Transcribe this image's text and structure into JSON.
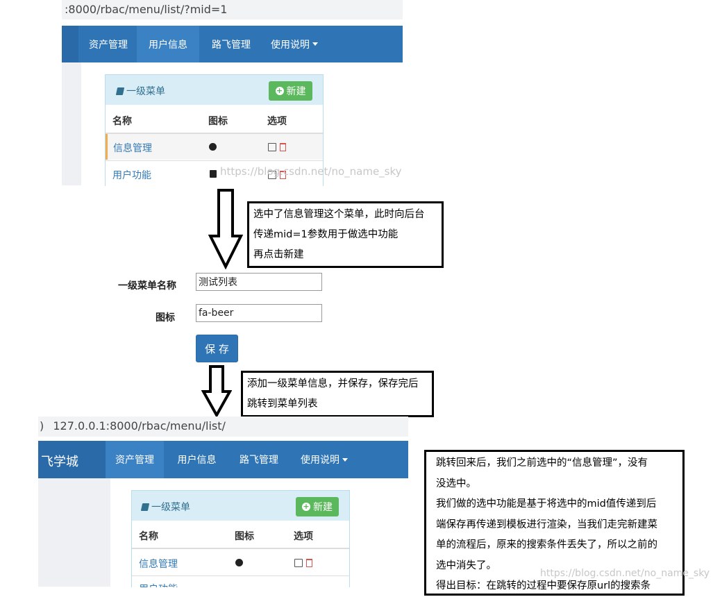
{
  "top": {
    "url": ":8000/rbac/menu/list/?mid=1",
    "nav": [
      {
        "label": "资产管理"
      },
      {
        "label": "用户信息"
      },
      {
        "label": "路飞管理"
      },
      {
        "label": "使用说明"
      }
    ],
    "panel": {
      "title": "一级菜单",
      "new_label": "新建",
      "headers": [
        "名称",
        "图标",
        "选项"
      ],
      "rows": [
        {
          "name": "信息管理"
        },
        {
          "name": "用户功能"
        }
      ]
    },
    "watermark": "https://blog.csdn.net/no_name_sky"
  },
  "note1": {
    "lines": [
      "选中了信息管理这个菜单，此时向后台",
      "传递mid=1参数用于做选中功能",
      "再点击新建"
    ]
  },
  "form": {
    "name_label": "一级菜单名称",
    "name_value": "测试列表",
    "icon_label": "图标",
    "icon_value": "fa-beer",
    "save_label": "保 存"
  },
  "note2": {
    "lines": [
      "添加一级菜单信息，并保存，保存完后",
      "跳转到菜单列表"
    ]
  },
  "bottom": {
    "url_prefix": ")",
    "url": "127.0.0.1:8000/rbac/menu/list/",
    "brand": "飞学城",
    "nav": [
      {
        "label": "资产管理"
      },
      {
        "label": "用户信息"
      },
      {
        "label": "路飞管理"
      },
      {
        "label": "使用说明"
      }
    ],
    "panel": {
      "title": "一级菜单",
      "new_label": "新建",
      "headers": [
        "名称",
        "图标",
        "选项"
      ],
      "rows": [
        {
          "name": "信息管理"
        },
        {
          "name": "用户功能"
        }
      ]
    },
    "watermark": "https://blog.csdn.net/no_name_sky"
  },
  "note3": {
    "lines": [
      "跳转回来后，我们之前选中的“信息管理”，没有",
      "没选中。",
      "我们做的选中功能是基于将选中的mid值传递到后",
      "端保存再传递到模板进行渲染，当我们走完新建菜",
      "单的流程后，原来的搜索条件丢失了，所以之前的",
      "选中消失了。",
      "得出目标：在跳转的过程中要保存原url的搜索条"
    ]
  }
}
